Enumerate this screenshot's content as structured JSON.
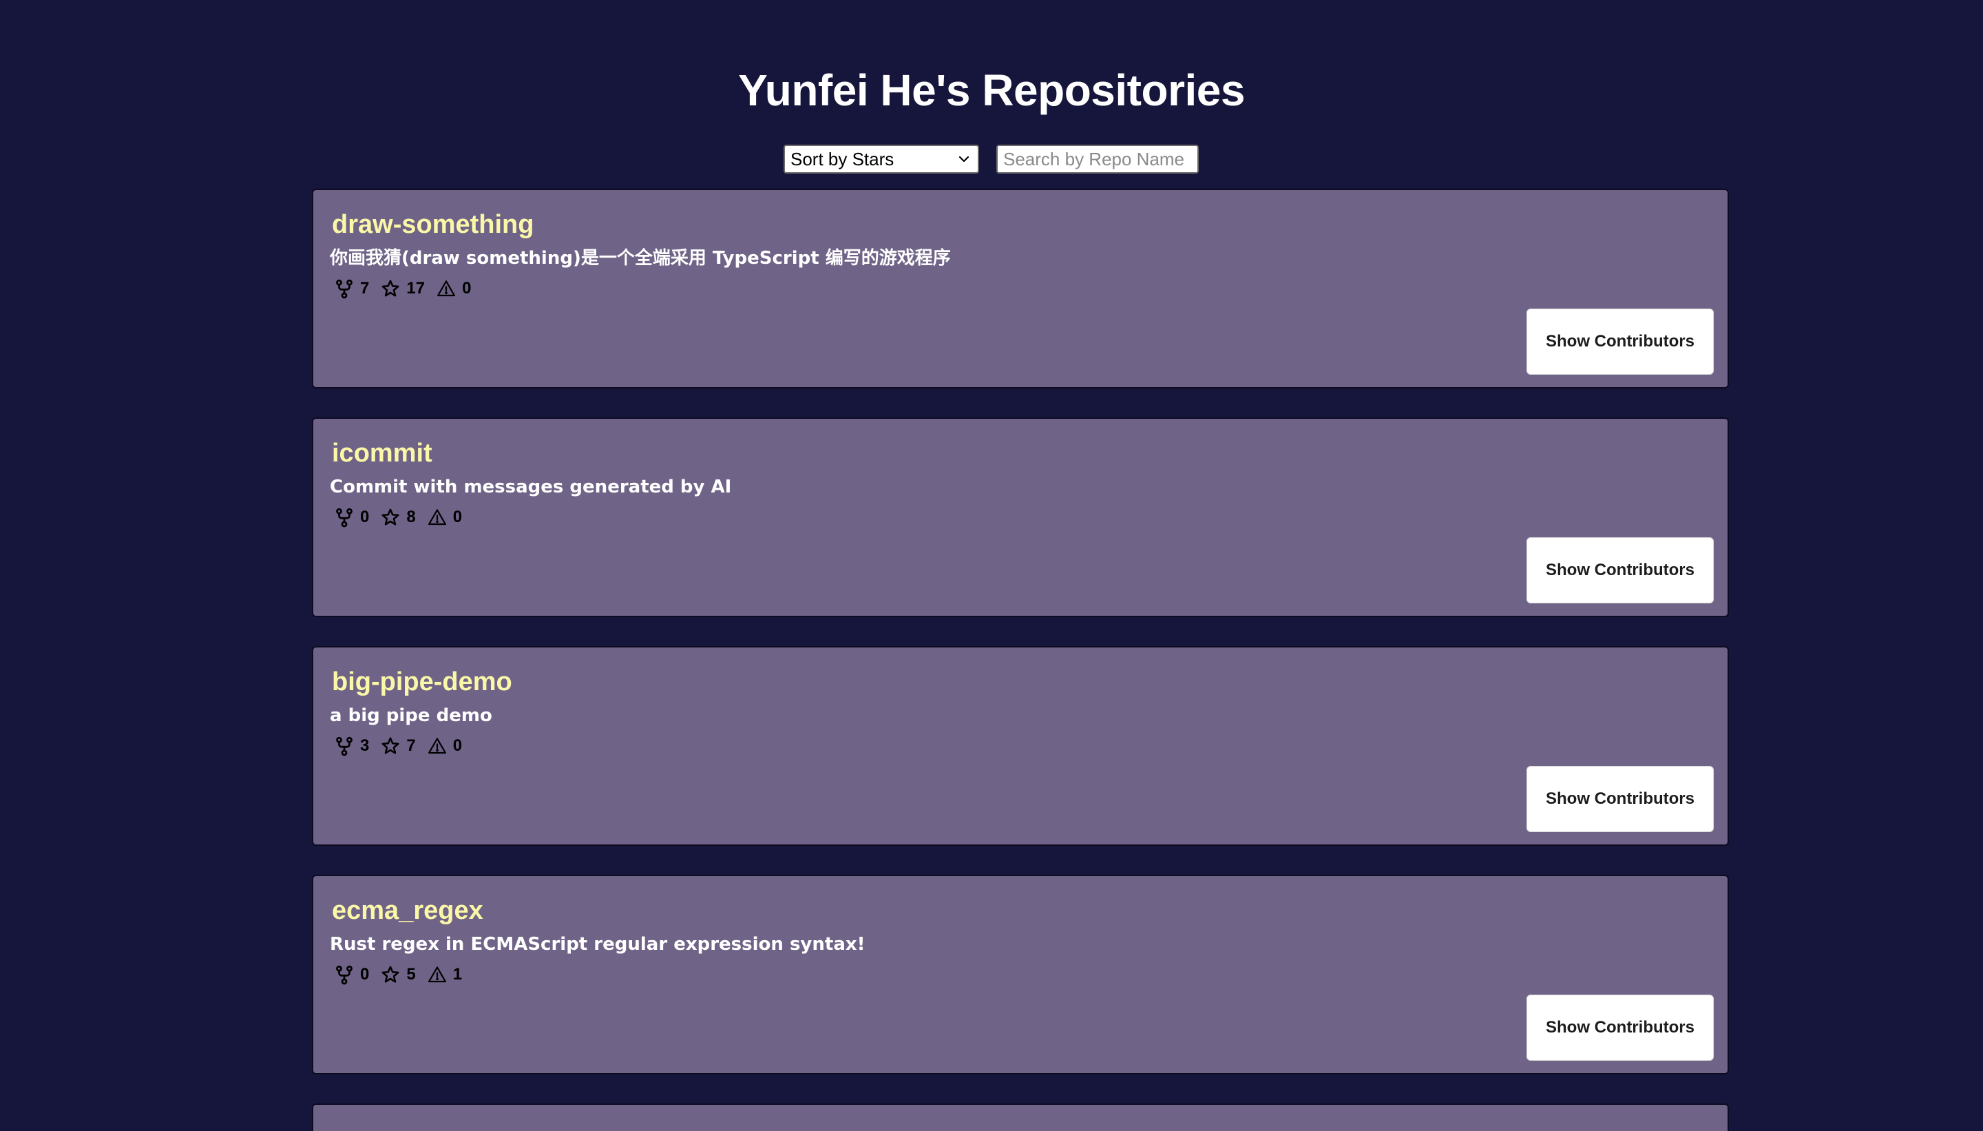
{
  "page": {
    "title": "Yunfei He's Repositories"
  },
  "controls": {
    "sort_selected": "Sort by Stars",
    "search_placeholder": "Search by Repo Name",
    "search_value": ""
  },
  "icons": {
    "fork": "fork-icon",
    "star": "star-icon",
    "issue": "warning-triangle-icon",
    "chevron": "chevron-down-icon"
  },
  "repos": [
    {
      "name": "draw-something",
      "description": "你画我猜(draw something)是一个全端采用 TypeScript 编写的游戏程序",
      "forks": "7",
      "stars": "17",
      "issues": "0",
      "button_label": "Show Contributors"
    },
    {
      "name": "icommit",
      "description": "Commit with messages generated by AI",
      "forks": "0",
      "stars": "8",
      "issues": "0",
      "button_label": "Show Contributors"
    },
    {
      "name": "big-pipe-demo",
      "description": "a big pipe demo",
      "forks": "3",
      "stars": "7",
      "issues": "0",
      "button_label": "Show Contributors"
    },
    {
      "name": "ecma_regex",
      "description": "Rust regex in ECMAScript regular expression syntax!",
      "forks": "0",
      "stars": "5",
      "issues": "1",
      "button_label": "Show Contributors"
    }
  ],
  "colors": {
    "background": "#16153b",
    "card": "#6f6387",
    "repo_name": "#fbf7a8"
  }
}
